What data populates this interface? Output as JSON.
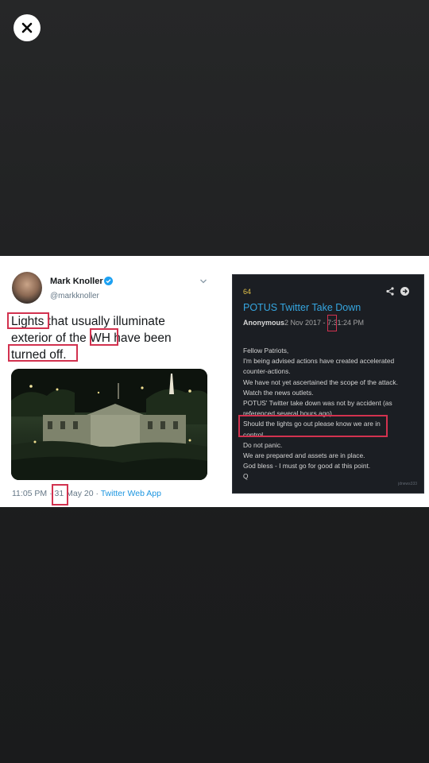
{
  "viewer": {
    "close_label": "close"
  },
  "tweet": {
    "name": "Mark Knoller",
    "handle": "@markknoller",
    "text_lines": [
      "Lights that usually illuminate",
      "exterior of the WH have been",
      "turned off."
    ],
    "time": "11:05 PM ·",
    "day": "31",
    "month_year": "May 20",
    "separator": "·",
    "app": "Twitter Web App",
    "colors": {
      "link": "#1b95e0",
      "highlight": "#d2324f",
      "verified": "#1da1f2"
    }
  },
  "qpost": {
    "number": "64",
    "title": "POTUS Twitter Take Down",
    "author": "Anonymous",
    "date": "2 Nov 2017 - 7:31:24 PM",
    "body_lines": [
      "Fellow Patriots,",
      "I'm being advised actions have created accelerated",
      "counter-actions.",
      "We have not yet ascertained the scope of the attack.",
      "Watch the news outlets.",
      "POTUS' Twitter take down was not by accident (as",
      "referenced several hours ago).",
      "Should the lights go out please know we are in",
      "control.",
      "Do not panic.",
      "We are prepared and assets are in place.",
      "God bless - I must go for good at this point.",
      "Q"
    ],
    "signature": "jdnews333",
    "colors": {
      "title": "#35a6e0",
      "number": "#e2c24a",
      "background": "#1b1e23"
    }
  }
}
